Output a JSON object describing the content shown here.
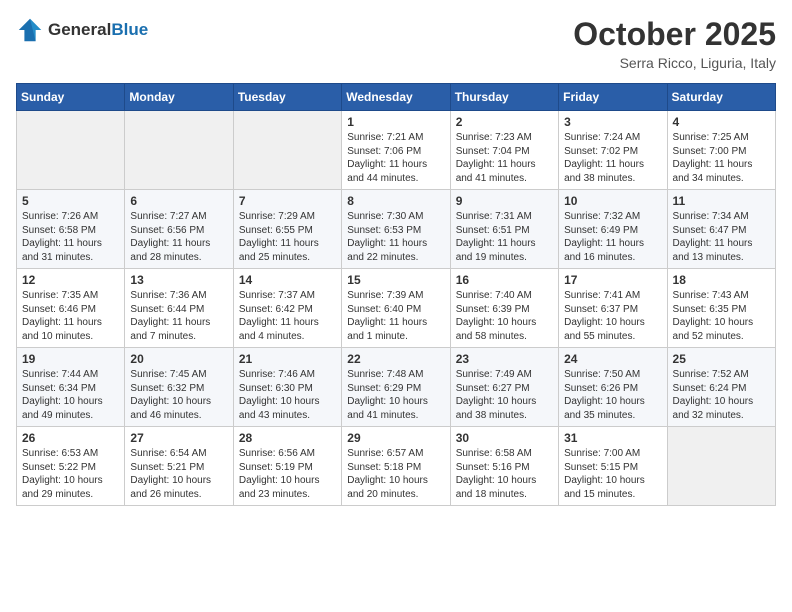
{
  "logo": {
    "general": "General",
    "blue": "Blue"
  },
  "header": {
    "month": "October 2025",
    "location": "Serra Ricco, Liguria, Italy"
  },
  "weekdays": [
    "Sunday",
    "Monday",
    "Tuesday",
    "Wednesday",
    "Thursday",
    "Friday",
    "Saturday"
  ],
  "weeks": [
    [
      {
        "day": "",
        "info": ""
      },
      {
        "day": "",
        "info": ""
      },
      {
        "day": "",
        "info": ""
      },
      {
        "day": "1",
        "info": "Sunrise: 7:21 AM\nSunset: 7:06 PM\nDaylight: 11 hours\nand 44 minutes."
      },
      {
        "day": "2",
        "info": "Sunrise: 7:23 AM\nSunset: 7:04 PM\nDaylight: 11 hours\nand 41 minutes."
      },
      {
        "day": "3",
        "info": "Sunrise: 7:24 AM\nSunset: 7:02 PM\nDaylight: 11 hours\nand 38 minutes."
      },
      {
        "day": "4",
        "info": "Sunrise: 7:25 AM\nSunset: 7:00 PM\nDaylight: 11 hours\nand 34 minutes."
      }
    ],
    [
      {
        "day": "5",
        "info": "Sunrise: 7:26 AM\nSunset: 6:58 PM\nDaylight: 11 hours\nand 31 minutes."
      },
      {
        "day": "6",
        "info": "Sunrise: 7:27 AM\nSunset: 6:56 PM\nDaylight: 11 hours\nand 28 minutes."
      },
      {
        "day": "7",
        "info": "Sunrise: 7:29 AM\nSunset: 6:55 PM\nDaylight: 11 hours\nand 25 minutes."
      },
      {
        "day": "8",
        "info": "Sunrise: 7:30 AM\nSunset: 6:53 PM\nDaylight: 11 hours\nand 22 minutes."
      },
      {
        "day": "9",
        "info": "Sunrise: 7:31 AM\nSunset: 6:51 PM\nDaylight: 11 hours\nand 19 minutes."
      },
      {
        "day": "10",
        "info": "Sunrise: 7:32 AM\nSunset: 6:49 PM\nDaylight: 11 hours\nand 16 minutes."
      },
      {
        "day": "11",
        "info": "Sunrise: 7:34 AM\nSunset: 6:47 PM\nDaylight: 11 hours\nand 13 minutes."
      }
    ],
    [
      {
        "day": "12",
        "info": "Sunrise: 7:35 AM\nSunset: 6:46 PM\nDaylight: 11 hours\nand 10 minutes."
      },
      {
        "day": "13",
        "info": "Sunrise: 7:36 AM\nSunset: 6:44 PM\nDaylight: 11 hours\nand 7 minutes."
      },
      {
        "day": "14",
        "info": "Sunrise: 7:37 AM\nSunset: 6:42 PM\nDaylight: 11 hours\nand 4 minutes."
      },
      {
        "day": "15",
        "info": "Sunrise: 7:39 AM\nSunset: 6:40 PM\nDaylight: 11 hours\nand 1 minute."
      },
      {
        "day": "16",
        "info": "Sunrise: 7:40 AM\nSunset: 6:39 PM\nDaylight: 10 hours\nand 58 minutes."
      },
      {
        "day": "17",
        "info": "Sunrise: 7:41 AM\nSunset: 6:37 PM\nDaylight: 10 hours\nand 55 minutes."
      },
      {
        "day": "18",
        "info": "Sunrise: 7:43 AM\nSunset: 6:35 PM\nDaylight: 10 hours\nand 52 minutes."
      }
    ],
    [
      {
        "day": "19",
        "info": "Sunrise: 7:44 AM\nSunset: 6:34 PM\nDaylight: 10 hours\nand 49 minutes."
      },
      {
        "day": "20",
        "info": "Sunrise: 7:45 AM\nSunset: 6:32 PM\nDaylight: 10 hours\nand 46 minutes."
      },
      {
        "day": "21",
        "info": "Sunrise: 7:46 AM\nSunset: 6:30 PM\nDaylight: 10 hours\nand 43 minutes."
      },
      {
        "day": "22",
        "info": "Sunrise: 7:48 AM\nSunset: 6:29 PM\nDaylight: 10 hours\nand 41 minutes."
      },
      {
        "day": "23",
        "info": "Sunrise: 7:49 AM\nSunset: 6:27 PM\nDaylight: 10 hours\nand 38 minutes."
      },
      {
        "day": "24",
        "info": "Sunrise: 7:50 AM\nSunset: 6:26 PM\nDaylight: 10 hours\nand 35 minutes."
      },
      {
        "day": "25",
        "info": "Sunrise: 7:52 AM\nSunset: 6:24 PM\nDaylight: 10 hours\nand 32 minutes."
      }
    ],
    [
      {
        "day": "26",
        "info": "Sunrise: 6:53 AM\nSunset: 5:22 PM\nDaylight: 10 hours\nand 29 minutes."
      },
      {
        "day": "27",
        "info": "Sunrise: 6:54 AM\nSunset: 5:21 PM\nDaylight: 10 hours\nand 26 minutes."
      },
      {
        "day": "28",
        "info": "Sunrise: 6:56 AM\nSunset: 5:19 PM\nDaylight: 10 hours\nand 23 minutes."
      },
      {
        "day": "29",
        "info": "Sunrise: 6:57 AM\nSunset: 5:18 PM\nDaylight: 10 hours\nand 20 minutes."
      },
      {
        "day": "30",
        "info": "Sunrise: 6:58 AM\nSunset: 5:16 PM\nDaylight: 10 hours\nand 18 minutes."
      },
      {
        "day": "31",
        "info": "Sunrise: 7:00 AM\nSunset: 5:15 PM\nDaylight: 10 hours\nand 15 minutes."
      },
      {
        "day": "",
        "info": ""
      }
    ]
  ]
}
